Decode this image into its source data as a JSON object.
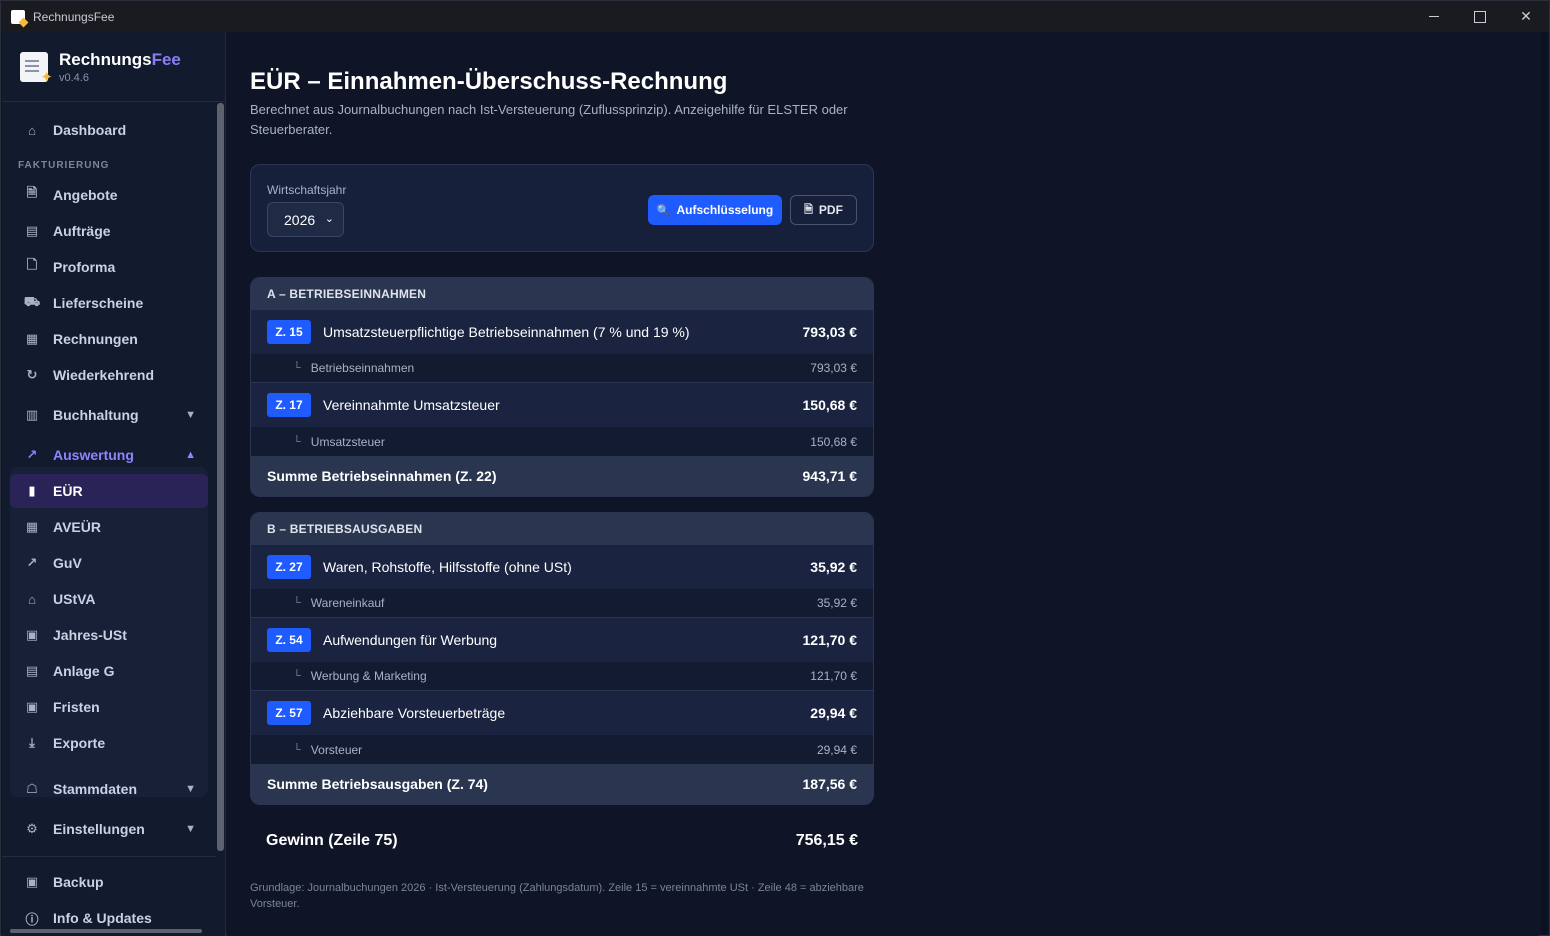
{
  "window": {
    "title": "RechnungsFee"
  },
  "brand": {
    "name_main": "Rechnungs",
    "name_accent": "Fee",
    "version": "v0.4.6"
  },
  "sidebar": {
    "dashboard": "Dashboard",
    "section_fakturierung": "FAKTURIERUNG",
    "angebote": "Angebote",
    "auftraege": "Aufträge",
    "proforma": "Proforma",
    "lieferscheine": "Lieferscheine",
    "rechnungen": "Rechnungen",
    "wiederkehrend": "Wiederkehrend",
    "buchhaltung": "Buchhaltung",
    "auswertung": "Auswertung",
    "eur": "EÜR",
    "aveur": "AVEÜR",
    "guv": "GuV",
    "ustva": "UStVA",
    "jahres_ust": "Jahres-USt",
    "anlage_g": "Anlage G",
    "fristen": "Fristen",
    "exporte": "Exporte",
    "stammdaten": "Stammdaten",
    "einstellungen": "Einstellungen",
    "backup": "Backup",
    "info": "Info & Updates"
  },
  "page": {
    "title": "EÜR – Einnahmen-Überschuss-Rechnung",
    "subtitle": "Berechnet aus Journalbuchungen nach Ist-Versteuerung (Zuflussprinzip). Anzeigehilfe für ELSTER oder Steuerberater."
  },
  "filter": {
    "label": "Wirtschaftsjahr",
    "year": "2026",
    "breakdown_button": "Aufschlüsselung",
    "pdf_button": "PDF"
  },
  "income": {
    "heading": "A – BETRIEBSEINNAHMEN",
    "rows": [
      {
        "line": "Z. 15",
        "label": "Umsatzsteuerpflichtige Betriebseinnahmen (7 % und 19 %)",
        "amount": "793,03 €",
        "sub_label": "Betriebseinnahmen",
        "sub_amount": "793,03 €"
      },
      {
        "line": "Z. 17",
        "label": "Vereinnahmte Umsatzsteuer",
        "amount": "150,68 €",
        "sub_label": "Umsatzsteuer",
        "sub_amount": "150,68 €"
      }
    ],
    "sum_label": "Summe Betriebseinnahmen (Z. 22)",
    "sum_amount": "943,71 €"
  },
  "expenses": {
    "heading": "B – BETRIEBSAUSGABEN",
    "rows": [
      {
        "line": "Z. 27",
        "label": "Waren, Rohstoffe, Hilfsstoffe (ohne USt)",
        "amount": "35,92 €",
        "sub_label": "Wareneinkauf",
        "sub_amount": "35,92 €"
      },
      {
        "line": "Z. 54",
        "label": "Aufwendungen für Werbung",
        "amount": "121,70 €",
        "sub_label": "Werbung & Marketing",
        "sub_amount": "121,70 €"
      },
      {
        "line": "Z. 57",
        "label": "Abziehbare Vorsteuerbeträge",
        "amount": "29,94 €",
        "sub_label": "Vorsteuer",
        "sub_amount": "29,94 €"
      }
    ],
    "sum_label": "Summe Betriebsausgaben (Z. 74)",
    "sum_amount": "187,56 €"
  },
  "profit": {
    "label": "Gewinn (Zeile 75)",
    "amount": "756,15 €"
  },
  "footnote": "Grundlage: Journalbuchungen 2026 · Ist-Versteuerung (Zahlungsdatum). Zeile 15 = vereinnahmte USt · Zeile 48 = abziehbare Vorsteuer.",
  "colors": {
    "accent": "#1f5cff",
    "active_nav": "#8f83ff",
    "background": "#0f1526"
  }
}
